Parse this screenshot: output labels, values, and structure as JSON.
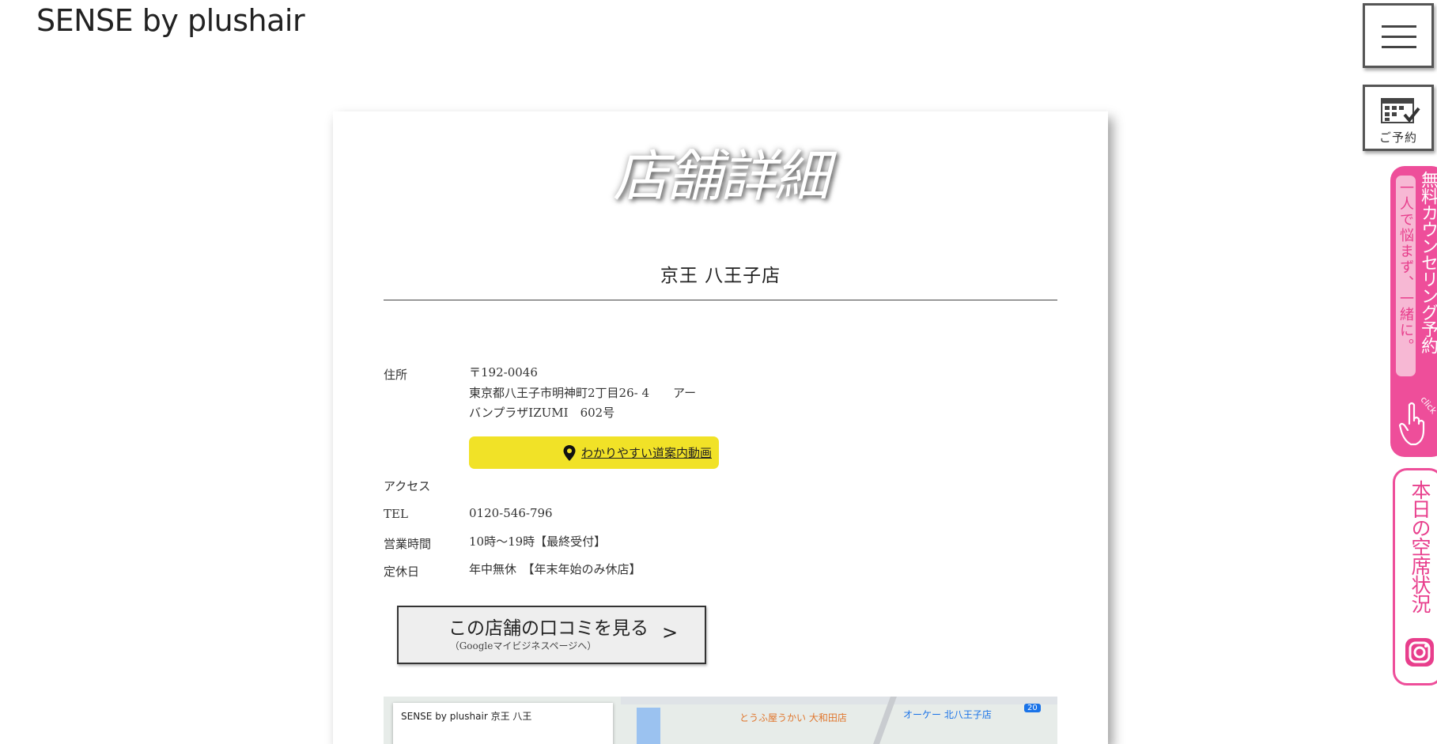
{
  "header": {
    "logo": "SENSE by plushair"
  },
  "page": {
    "title": "店舗詳細",
    "store_name": "京王 八王子店"
  },
  "details": {
    "address_label": "住所",
    "address_lines": [
      "〒192-0046",
      "東京都八王子市明神町2丁目26- 4　　アー",
      "バンプラザIZUMI　602号"
    ],
    "route_button": "わかりやすい道案内動画",
    "access_label": "アクセス",
    "tel_label": "TEL",
    "tel_value": "0120-546-796",
    "hours_label": "営業時間",
    "hours_value": "10時～19時【最終受付】",
    "holiday_label": "定休日",
    "holiday_value": "年中無休　【年末年始のみ休店】"
  },
  "review_button": {
    "label": "この店舗の口コミを見る",
    "sub": "（Googleマイビジネスページへ）",
    "arrow": ">"
  },
  "map": {
    "card_title": "SENSE by plushair 京王 八王",
    "poi_1": "とうふ屋うかい 大和田店",
    "poi_2": "オーケー 北八王子店",
    "road_badge": "20"
  },
  "side": {
    "reserve_label": "ご予約",
    "counseling_main": "無料カウンセリング予約",
    "counseling_sub": "一人で悩まず、一緒に。",
    "counseling_click": "click",
    "vacancy": "本日の空席状況"
  },
  "colors": {
    "accent_pink": "#ee4e9a",
    "button_yellow": "#f1e227"
  },
  "icons": [
    "hamburger-menu-icon",
    "calendar-check-icon",
    "map-pin-icon",
    "hand-pointer-icon",
    "instagram-icon"
  ]
}
